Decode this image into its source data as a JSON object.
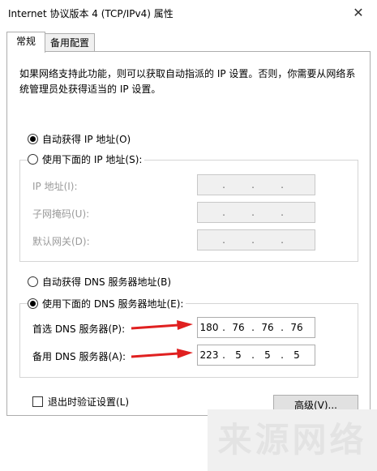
{
  "window": {
    "title": "Internet 协议版本 4 (TCP/IPv4) 属性"
  },
  "tabs": [
    {
      "label": "常规"
    },
    {
      "label": "备用配置"
    }
  ],
  "description": "如果网络支持此功能，则可以获取自动指派的 IP 设置。否则，你需要从网络系统管理员处获得适当的 IP 设置。",
  "ip": {
    "auto_label": "自动获得 IP 地址(O)",
    "manual_label": "使用下面的 IP 地址(S):",
    "selected": "auto",
    "fields": [
      {
        "label": "IP 地址(I):",
        "value": [
          "",
          "",
          "",
          ""
        ]
      },
      {
        "label": "子网掩码(U):",
        "value": [
          "",
          "",
          "",
          ""
        ]
      },
      {
        "label": "默认网关(D):",
        "value": [
          "",
          "",
          "",
          ""
        ]
      }
    ]
  },
  "dns": {
    "auto_label": "自动获得 DNS 服务器地址(B)",
    "manual_label": "使用下面的 DNS 服务器地址(E):",
    "selected": "manual",
    "preferred": {
      "label": "首选 DNS 服务器(P):",
      "octets": [
        "180",
        "76",
        "76",
        "76"
      ]
    },
    "alternate": {
      "label": "备用 DNS 服务器(A):",
      "octets": [
        "223",
        "5",
        "5",
        "5"
      ]
    }
  },
  "validate": {
    "label": "退出时验证设置(L)",
    "checked": false
  },
  "advanced_button": "高级(V)...",
  "watermark": "来源网络",
  "colors": {
    "arrow": "#e02020",
    "disabled_text": "#9a9a9a"
  }
}
